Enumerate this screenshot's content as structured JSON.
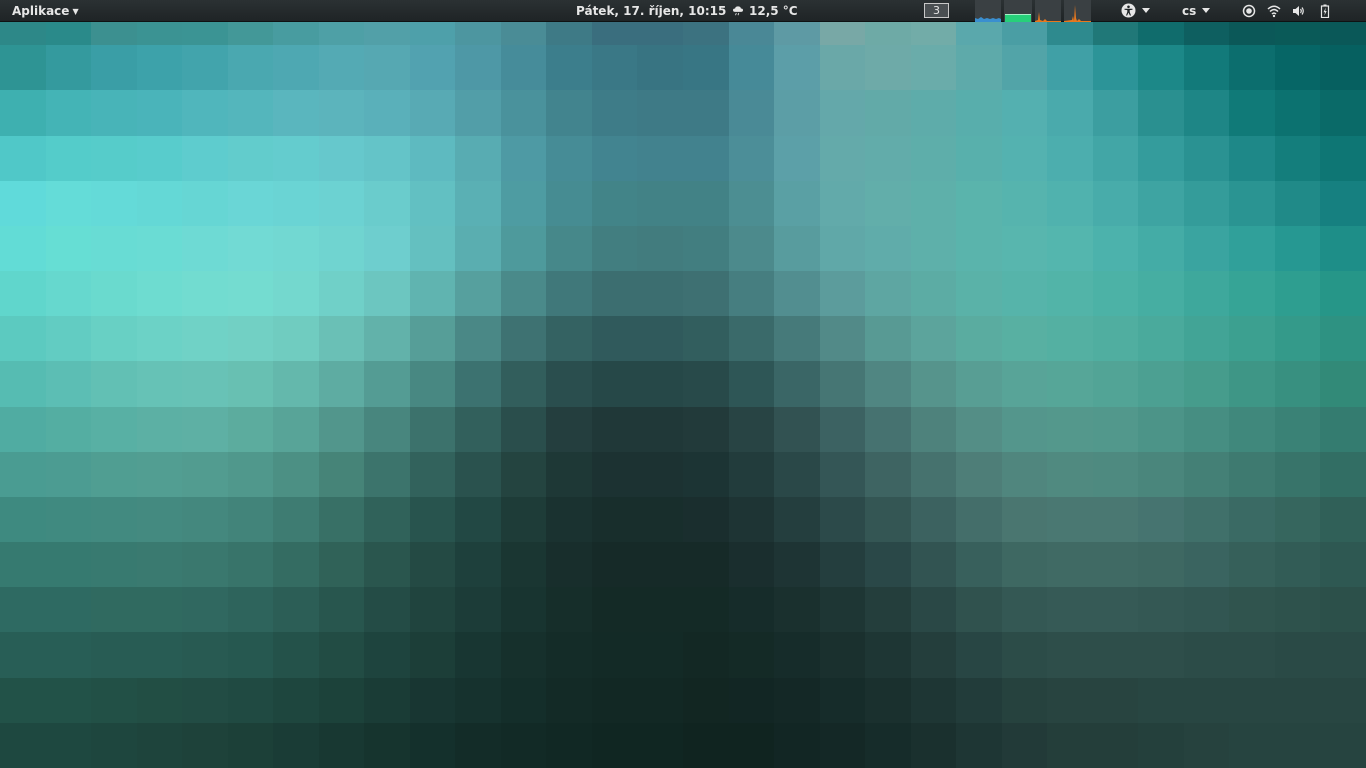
{
  "panel": {
    "apps_menu_label": "Aplikace",
    "clock": "Pátek, 17. říjen, 10:15",
    "weather": {
      "icon": "cloud-rain-icon",
      "temperature": "12,5 °C"
    },
    "workspace": "3",
    "keyboard_layout": "cs",
    "tray_icons": [
      "accessibility-icon",
      "network-status-icon",
      "wifi-icon",
      "volume-icon",
      "battery-icon"
    ]
  },
  "system_monitor": {
    "cpu_color": "#3a8fd0",
    "memory_color": "#27d07a",
    "network_color": "#e8781e"
  },
  "wallpaper": {
    "palette": [
      "#2d8888",
      "#2a8a8a",
      "#3c9090",
      "#3b9393",
      "#3b9494",
      "#439898",
      "#489ca0",
      "#4ea0a6",
      "#52a0a8",
      "#4ea0aa",
      "#4d96a0",
      "#4a8c96",
      "#3e7a86",
      "#3a6e7e",
      "#3a6e7e",
      "#3c7280",
      "#4a8896",
      "#5e9aa4",
      "#78a8a6",
      "#6eaaa6",
      "#72aca8",
      "#5aa8ac",
      "#4a9ea4",
      "#2e8a8e",
      "#207878",
      "#106c6c",
      "#0e5f60",
      "#0b5858",
      "#0a5a58",
      "#0a5858",
      "#2e9494",
      "#349a9e",
      "#3a9ea6",
      "#3da2aa",
      "#42a4ac",
      "#4aa8b0",
      "#4ea8b2",
      "#54aab4",
      "#56a8b2",
      "#52a2b0",
      "#4e98a6",
      "#468c9a",
      "#3c7e8c",
      "#3a7886",
      "#387482",
      "#387684",
      "#468a98",
      "#5c9ea8",
      "#6aa8a8",
      "#6eaaa8",
      "#6aacaa",
      "#5eaaaa",
      "#52a4a8",
      "#40a0a6",
      "#2c9498",
      "#1c8888",
      "#127a7a",
      "#0c6e6e",
      "#066666",
      "#066060",
      "#3eb0b0",
      "#44b4b6",
      "#48b4b8",
      "#4ab4ba",
      "#50b6bc",
      "#54b6bc",
      "#5ab6be",
      "#5cb4bc",
      "#5ab0ba",
      "#58aab4",
      "#529ea8",
      "#4a929c",
      "#42848e",
      "#3e7c88",
      "#3e7a86",
      "#3e7a86",
      "#4a8a96",
      "#5c9ea6",
      "#64a8aa",
      "#62aaa8",
      "#5eacaa",
      "#58aeac",
      "#54b0b0",
      "#4aaaac",
      "#3c9ea0",
      "#2a9090",
      "#1e8686",
      "#107a78",
      "#0c7270",
      "#0a6a68",
      "#50c8c8",
      "#54ccca",
      "#56ccca",
      "#58cccc",
      "#5eccce",
      "#62cccc",
      "#64ccce",
      "#66c8cc",
      "#64c4c8",
      "#5ebac0",
      "#58acb2",
      "#4e9aa4",
      "#468c96",
      "#428490",
      "#42828e",
      "#42828e",
      "#4c8e98",
      "#5ca0a8",
      "#64aaaa",
      "#62acaa",
      "#5eaeaa",
      "#58b0ac",
      "#54b2b0",
      "#4caeae",
      "#42a6a6",
      "#349c9c",
      "#2a9292",
      "#1e8888",
      "#147e7c",
      "#0e7674",
      "#60dada",
      "#64dcd8",
      "#64dad8",
      "#64d8d6",
      "#66d6d4",
      "#6ad6d6",
      "#6ad4d4",
      "#6cd2d2",
      "#6acccc",
      "#62c0c2",
      "#5ab0b4",
      "#4e9ca2",
      "#468c92",
      "#428488",
      "#428286",
      "#428286",
      "#4c8e92",
      "#5aa0a4",
      "#62aaaa",
      "#62aeaa",
      "#5eb0aa",
      "#5ab4ac",
      "#56b4ae",
      "#50b2ae",
      "#48acaa",
      "#3ea4a2",
      "#349c9a",
      "#2a9492",
      "#208a88",
      "#168080",
      "#62dcd6",
      "#66ded4",
      "#68dcd4",
      "#6adcd4",
      "#6edad4",
      "#72dad4",
      "#72d8d2",
      "#70d4d0",
      "#6ecece",
      "#64c0c0",
      "#5aaeb0",
      "#4e9a9c",
      "#46888a",
      "#427e80",
      "#427c7e",
      "#427e80",
      "#4c8a8c",
      "#589c9e",
      "#60a8a8",
      "#60acaa",
      "#5eb0aa",
      "#5ab4ac",
      "#58b6ae",
      "#54b6ae",
      "#4cb2ac",
      "#44aca6",
      "#3aa4a0",
      "#30a09a",
      "#269892",
      "#1e8e88",
      "#60d6cc",
      "#66d8ce",
      "#6adace",
      "#6edcd0",
      "#72dcd0",
      "#74dcd0",
      "#74d8ce",
      "#70d0c8",
      "#6cc6c0",
      "#60b4b0",
      "#56a09e",
      "#4a8a8a",
      "#40787a",
      "#3c6e70",
      "#3c6e70",
      "#3e7072",
      "#467e80",
      "#528e90",
      "#5c9c9c",
      "#5ea6a2",
      "#5caca4",
      "#5ab2a8",
      "#56b4aa",
      "#52b4a8",
      "#4cb2a6",
      "#46aea2",
      "#3ea89c",
      "#36a496",
      "#2e9e90",
      "#269688",
      "#5ccac0",
      "#62ccc2",
      "#68d0c4",
      "#6cd2c6",
      "#70d2c6",
      "#72d0c4",
      "#70ccc0",
      "#6ac0b6",
      "#62b2aa",
      "#569e98",
      "#4a8886",
      "#3e7272",
      "#346262",
      "#305a5c",
      "#305a5c",
      "#325e5e",
      "#3a6a6a",
      "#467a7a",
      "#528a88",
      "#589a94",
      "#5ca49c",
      "#5aaca0",
      "#58b0a2",
      "#54b0a2",
      "#50aea0",
      "#4aaa9c",
      "#42a496",
      "#3ca090",
      "#349a8a",
      "#2e9282",
      "#56bcb2",
      "#5cbeb4",
      "#62c0b4",
      "#66c2b6",
      "#68c2b6",
      "#68c0b2",
      "#64b8ac",
      "#5eaca2",
      "#549c94",
      "#488882",
      "#3c7270",
      "#325e5c",
      "#2a4e4e",
      "#264848",
      "#264848",
      "#284a4a",
      "#2e5656",
      "#3a6666",
      "#467674",
      "#508682",
      "#56948c",
      "#589e94",
      "#58a498",
      "#56a698",
      "#52a496",
      "#4ca092",
      "#469c8c",
      "#3e9686",
      "#389080",
      "#328a78",
      "#50aca2",
      "#54aea2",
      "#58b0a4",
      "#5cb0a4",
      "#5eb0a4",
      "#5cac9e",
      "#58a498",
      "#52968c",
      "#48867e",
      "#3c726c",
      "#32605c",
      "#2a4e4c",
      "#243e3e",
      "#203838",
      "#203838",
      "#223a3a",
      "#284444",
      "#325252",
      "#3c6262",
      "#467270",
      "#4e827c",
      "#548e86",
      "#54968c",
      "#54988c",
      "#52988c",
      "#4c9488",
      "#468e82",
      "#40887c",
      "#3a8276",
      "#347c70",
      "#4a9c92",
      "#4c9c92",
      "#509e92",
      "#529e92",
      "#529c90",
      "#50988c",
      "#4c9084",
      "#468478",
      "#3c746c",
      "#32625c",
      "#2a524e",
      "#244440",
      "#1e3836",
      "#1c3232",
      "#1c3232",
      "#1c3434",
      "#223c3c",
      "#2a4848",
      "#345656",
      "#3e6462",
      "#46726e",
      "#4e7e78",
      "#50867e",
      "#508a80",
      "#4e8a80",
      "#4a867c",
      "#448076",
      "#3e7a70",
      "#38746a",
      "#326e64",
      "#3e8a80",
      "#408a80",
      "#428a80",
      "#448a80",
      "#44887e",
      "#42847a",
      "#3e7c72",
      "#387066",
      "#30625a",
      "#28544e",
      "#224844",
      "#1e3c38",
      "#1a3230",
      "#182e2c",
      "#182e2c",
      "#1a2e2e",
      "#1e3434",
      "#243e3e",
      "#2c4a4a",
      "#345654",
      "#3c6260",
      "#446e6a",
      "#4a7670",
      "#4a7872",
      "#4a7872",
      "#467470",
      "#40706a",
      "#3a6a64",
      "#36665e",
      "#306058",
      "#367a70",
      "#367a70",
      "#387a70",
      "#3a7a70",
      "#3a786e",
      "#38746a",
      "#346c62",
      "#306258",
      "#2a564e",
      "#244a44",
      "#1e403c",
      "#1a3632",
      "#182e2c",
      "#162a28",
      "#162a28",
      "#162a28",
      "#1a2e2e",
      "#1e3434",
      "#243e3e",
      "#2a4848",
      "#325452",
      "#38605c",
      "#3e6862",
      "#406a64",
      "#406a64",
      "#3e6862",
      "#3a6460",
      "#36605a",
      "#325c56",
      "#2e5852",
      "#2e6a62",
      "#2e6a62",
      "#306a60",
      "#306a60",
      "#306860",
      "#2e645c",
      "#2c5e56",
      "#28564e",
      "#244c46",
      "#20443e",
      "#1c3c38",
      "#183430",
      "#162e2a",
      "#142a26",
      "#142a26",
      "#142a26",
      "#162c2a",
      "#1a302e",
      "#1e3634",
      "#243e3c",
      "#2a4846",
      "#30524e",
      "#345854",
      "#365a56",
      "#365a56",
      "#345854",
      "#325652",
      "#30544e",
      "#2e524c",
      "#2c504a",
      "#285e56",
      "#285e56",
      "#285c54",
      "#285c54",
      "#285a52",
      "#265850",
      "#24524a",
      "#224c44",
      "#1e443e",
      "#1c3e38",
      "#183632",
      "#16302c",
      "#142c28",
      "#132a26",
      "#132a26",
      "#132824",
      "#142a26",
      "#162c2a",
      "#1a302e",
      "#1e3634",
      "#243e3c",
      "#284644",
      "#2c4c48",
      "#2e4e4a",
      "#2e4e4a",
      "#2e4e4a",
      "#2c4c48",
      "#2c4c48",
      "#2a4a46",
      "#2a4a46",
      "#225248",
      "#225248",
      "#225046",
      "#224e44",
      "#224c44",
      "#204a42",
      "#1e463e",
      "#1c423a",
      "#1a3c36",
      "#183632",
      "#16322e",
      "#142e2a",
      "#132a26",
      "#122824",
      "#122824",
      "#122622",
      "#122624",
      "#142826",
      "#162c2a",
      "#1a302e",
      "#1e3634",
      "#223c3a",
      "#26423e",
      "#284440",
      "#284440",
      "#284642",
      "#284642",
      "#284642",
      "#284642",
      "#284642",
      "#1e4840",
      "#1e4840",
      "#1e463e",
      "#1e443c",
      "#1e423a",
      "#1c4038",
      "#1a3c36",
      "#183832",
      "#16342e",
      "#14302c",
      "#132c28",
      "#122a26",
      "#112824",
      "#102622",
      "#102622",
      "#102420",
      "#102420",
      "#122624",
      "#142826",
      "#162c2a",
      "#1a302e",
      "#1e3634",
      "#223a38",
      "#243e3a",
      "#243e3a",
      "#24403c",
      "#26423e",
      "#264440",
      "#264440",
      "#264440"
    ]
  }
}
